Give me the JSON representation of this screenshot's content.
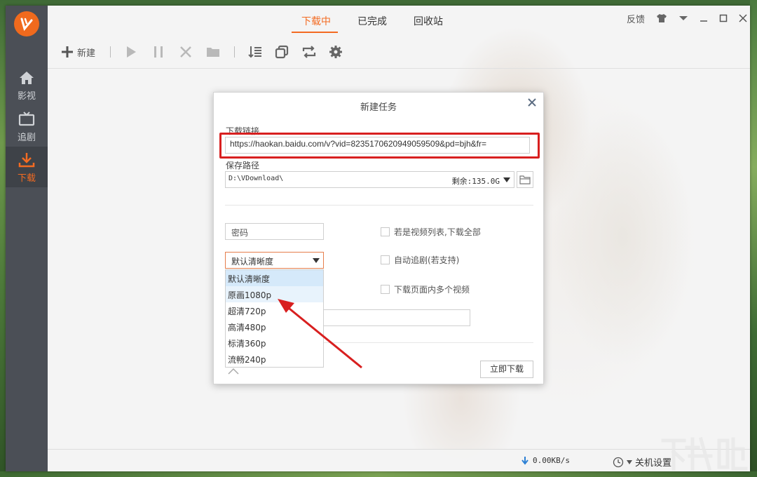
{
  "tabs": [
    {
      "label": "下载中"
    },
    {
      "label": "已完成"
    },
    {
      "label": "回收站"
    }
  ],
  "topright": {
    "feedback": "反馈"
  },
  "sidebar": {
    "items": [
      {
        "label": "影视",
        "icon": "home-icon"
      },
      {
        "label": "追剧",
        "icon": "tv-icon"
      },
      {
        "label": "下载",
        "icon": "download-icon"
      }
    ]
  },
  "toolbar": {
    "new_label": "新建"
  },
  "dialog": {
    "title": "新建任务",
    "url_label": "下载链接",
    "url_value": "https://haokan.baidu.com/v?vid=8235170620949059509&pd=bjh&fr=",
    "path_label": "保存路径",
    "path_value": "D:\\VDownload\\",
    "path_free": "剩余:135.0G",
    "password_placeholder": "密码",
    "quality_selected": "默认清晰度",
    "quality_options": [
      "默认清晰度",
      "原画1080p",
      "超清720p",
      "高清480p",
      "标清360p",
      "流畅240p"
    ],
    "checkboxes": [
      "若是视频列表,下载全部",
      "自动追剧(若支持)",
      "下载页面内多个视频"
    ],
    "download_button": "立即下载"
  },
  "status": {
    "speed": "0.00KB/s",
    "shutdown": "关机设置"
  },
  "colors": {
    "accent": "#f36b22",
    "highlight": "#d81f1f",
    "sidebar": "#4b4f56"
  }
}
